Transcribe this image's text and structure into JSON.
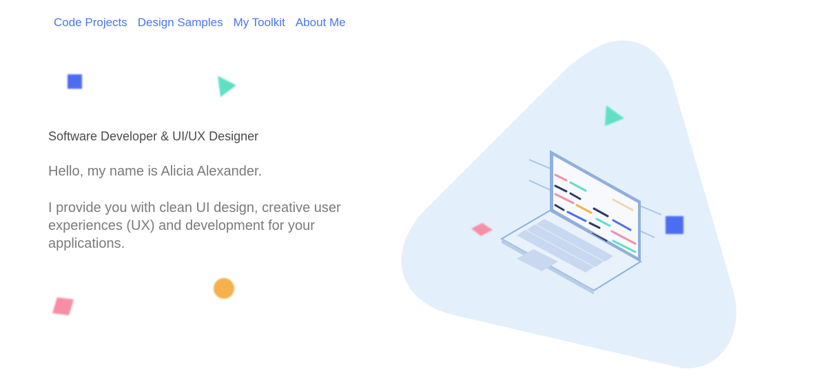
{
  "nav": {
    "items": [
      "Code Projects",
      "Design Samples",
      "My Toolkit",
      "About Me"
    ]
  },
  "hero": {
    "subtitle": "Software Developer & UI/UX Designer",
    "greeting": "Hello, my name is Alicia Alexander.",
    "intro": "I provide you with clean UI design, creative user experiences (UX) and development for your applications."
  },
  "colors": {
    "accent": "#4a74ee",
    "blob": "#e3f0fb",
    "teal": "#5fe0c5",
    "pink": "#f68ea4",
    "orange": "#f6b04d",
    "blue": "#4e6cf2"
  },
  "icons": [
    "laptop-illustration",
    "triangle-shape",
    "square-shape",
    "circle-shape",
    "diamond-shape"
  ]
}
